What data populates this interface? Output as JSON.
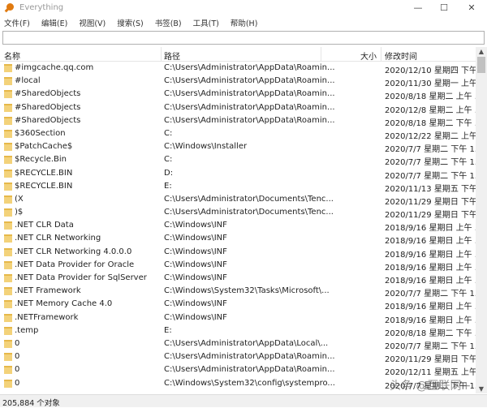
{
  "window": {
    "title": "Everything",
    "minimize": "—",
    "maximize": "☐",
    "close": "✕"
  },
  "menu": [
    "文件(F)",
    "编辑(E)",
    "视图(V)",
    "搜索(S)",
    "书签(B)",
    "工具(T)",
    "帮助(H)"
  ],
  "search": {
    "value": "",
    "placeholder": ""
  },
  "columns": {
    "name": "名称",
    "path": "路径",
    "size": "大小",
    "modified": "修改时间"
  },
  "rows": [
    {
      "name": "#imgcache.qq.com",
      "path": "C:\\Users\\Administrator\\AppData\\Roamin...",
      "modified": "2020/12/10 星期四 下午..."
    },
    {
      "name": "#local",
      "path": "C:\\Users\\Administrator\\AppData\\Roamin...",
      "modified": "2020/11/30 星期一 上午..."
    },
    {
      "name": "#SharedObjects",
      "path": "C:\\Users\\Administrator\\AppData\\Roamin...",
      "modified": "2020/8/18 星期二 上午 ..."
    },
    {
      "name": "#SharedObjects",
      "path": "C:\\Users\\Administrator\\AppData\\Roamin...",
      "modified": "2020/12/8 星期二 上午 ..."
    },
    {
      "name": "#SharedObjects",
      "path": "C:\\Users\\Administrator\\AppData\\Roamin...",
      "modified": "2020/8/18 星期二 下午 ..."
    },
    {
      "name": "$360Section",
      "path": "C:",
      "modified": "2020/12/22 星期二 上午..."
    },
    {
      "name": "$PatchCache$",
      "path": "C:\\Windows\\Installer",
      "modified": "2020/7/7 星期二 下午 1..."
    },
    {
      "name": "$Recycle.Bin",
      "path": "C:",
      "modified": "2020/7/7 星期二 下午 1..."
    },
    {
      "name": "$RECYCLE.BIN",
      "path": "D:",
      "modified": "2020/7/7 星期二 下午 1..."
    },
    {
      "name": "$RECYCLE.BIN",
      "path": "E:",
      "modified": "2020/11/13 星期五 下午..."
    },
    {
      "name": "(X",
      "path": "C:\\Users\\Administrator\\Documents\\Tenc...",
      "modified": "2020/11/29 星期日 下午..."
    },
    {
      "name": ")$",
      "path": "C:\\Users\\Administrator\\Documents\\Tenc...",
      "modified": "2020/11/29 星期日 下午..."
    },
    {
      "name": ".NET CLR Data",
      "path": "C:\\Windows\\INF",
      "modified": "2018/9/16 星期日 上午 ..."
    },
    {
      "name": ".NET CLR Networking",
      "path": "C:\\Windows\\INF",
      "modified": "2018/9/16 星期日 上午 ..."
    },
    {
      "name": ".NET CLR Networking 4.0.0.0",
      "path": "C:\\Windows\\INF",
      "modified": "2018/9/16 星期日 上午 ..."
    },
    {
      "name": ".NET Data Provider for Oracle",
      "path": "C:\\Windows\\INF",
      "modified": "2018/9/16 星期日 上午 ..."
    },
    {
      "name": ".NET Data Provider for SqlServer",
      "path": "C:\\Windows\\INF",
      "modified": "2018/9/16 星期日 上午 ..."
    },
    {
      "name": ".NET Framework",
      "path": "C:\\Windows\\System32\\Tasks\\Microsoft\\...",
      "modified": "2020/7/7 星期二 下午 1..."
    },
    {
      "name": ".NET Memory Cache 4.0",
      "path": "C:\\Windows\\INF",
      "modified": "2018/9/16 星期日 上午 ..."
    },
    {
      "name": ".NETFramework",
      "path": "C:\\Windows\\INF",
      "modified": "2018/9/16 星期日 上午 ..."
    },
    {
      "name": ".temp",
      "path": "E:",
      "modified": "2020/8/18 星期二 下午 ..."
    },
    {
      "name": "0",
      "path": "C:\\Users\\Administrator\\AppData\\Local\\...",
      "modified": "2020/7/7 星期二 下午 1..."
    },
    {
      "name": "0",
      "path": "C:\\Users\\Administrator\\AppData\\Roamin...",
      "modified": "2020/11/29 星期日 下午..."
    },
    {
      "name": "0",
      "path": "C:\\Users\\Administrator\\AppData\\Roamin...",
      "modified": "2020/12/11 星期五 上午..."
    },
    {
      "name": "0",
      "path": "C:\\Windows\\System32\\config\\systempro...",
      "modified": "2020/7/7 星期二 下午 1..."
    }
  ],
  "status": {
    "count": "205,884 个对象"
  },
  "watermark": "头条 @互联网+"
}
